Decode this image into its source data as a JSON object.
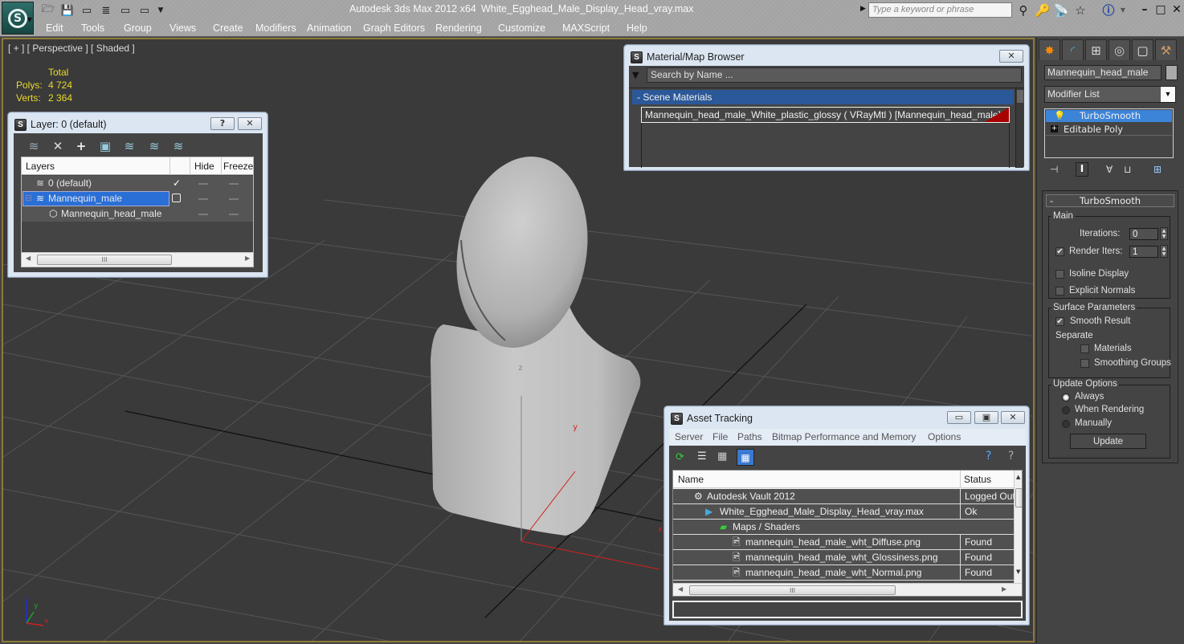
{
  "app": {
    "title": "Autodesk 3ds Max  2012 x64",
    "filename": "White_Egghead_Male_Display_Head_vray.max",
    "search_placeholder": "Type a keyword or phrase"
  },
  "menu": [
    "Edit",
    "Tools",
    "Group",
    "Views",
    "Create",
    "Modifiers",
    "Animation",
    "Graph Editors",
    "Rendering",
    "Customize",
    "MAXScript",
    "Help"
  ],
  "viewport": {
    "label": "[ + ] [ Perspective ] [ Shaded ]",
    "stats": {
      "header": "Total",
      "polys_label": "Polys:",
      "polys_value": "4 724",
      "verts_label": "Verts:",
      "verts_value": "2 364"
    },
    "gizmo": {
      "x": "x",
      "y": "y",
      "z": "z"
    },
    "corner_axes": {
      "x": "x",
      "y": "y",
      "z": "z"
    },
    "colors": {
      "x_axis": "#d02020",
      "y_axis": "#20a020",
      "z_axis": "#2020d0",
      "stats": "#e8d92a",
      "border": "#8e7a3a"
    }
  },
  "layer_dialog": {
    "title": "Layer: 0 (default)",
    "help_label": "?",
    "close_label": "✕",
    "columns": [
      "Layers",
      "",
      "Hide",
      "Freeze"
    ],
    "rows": [
      {
        "name": "0 (default)",
        "current": true,
        "selected": false
      },
      {
        "name": "Mannequin_male",
        "current": false,
        "selected": true
      },
      {
        "name": "Mannequin_head_male",
        "current": false,
        "selected": false
      }
    ],
    "scroll_thumb": "III"
  },
  "material_browser": {
    "title": "Material/Map Browser",
    "close_label": "✕",
    "search_placeholder": "Search by Name ...",
    "group_label": "-  Scene Materials",
    "item": "Mannequin_head_male_White_plastic_glossy  ( VRayMtl ) [Mannequin_head_male]"
  },
  "command_panel": {
    "object_name": "Mannequin_head_male",
    "modifier_list": "Modifier List",
    "stack": [
      "TurboSmooth",
      "Editable Poly"
    ],
    "rollout_title": "TurboSmooth",
    "rollout_collapse": "-",
    "main_group": "Main",
    "iterations_label": "Iterations:",
    "iterations_value": "0",
    "render_iters_label": "Render Iters:",
    "render_iters_value": "1",
    "render_iters_checked": true,
    "isoline_label": "Isoline Display",
    "explicit_normals_label": "Explicit Normals",
    "surface_group": "Surface Parameters",
    "smooth_result_label": "Smooth Result",
    "separate_label": "Separate",
    "materials_label": "Materials",
    "smoothing_groups_label": "Smoothing Groups",
    "update_group": "Update Options",
    "update_options": [
      "Always",
      "When Rendering",
      "Manually"
    ],
    "update_selected": "Always",
    "update_button": "Update"
  },
  "asset_tracking": {
    "title": "Asset Tracking",
    "menu": [
      "Server",
      "File",
      "Paths",
      "Bitmap Performance and Memory",
      "Options"
    ],
    "columns": [
      "Name",
      "Status"
    ],
    "rows": [
      {
        "name": "Autodesk Vault 2012",
        "status": "Logged Out"
      },
      {
        "name": "White_Egghead_Male_Display_Head_vray.max",
        "status": "Ok"
      },
      {
        "name": "Maps / Shaders",
        "status": ""
      },
      {
        "name": "mannequin_head_male_wht_Diffuse.png",
        "status": "Found"
      },
      {
        "name": "mannequin_head_male_wht_Glossiness.png",
        "status": "Found"
      },
      {
        "name": "mannequin_head_male_wht_Normal.png",
        "status": "Found"
      }
    ],
    "scroll_thumb": "III",
    "status_bar": ""
  }
}
